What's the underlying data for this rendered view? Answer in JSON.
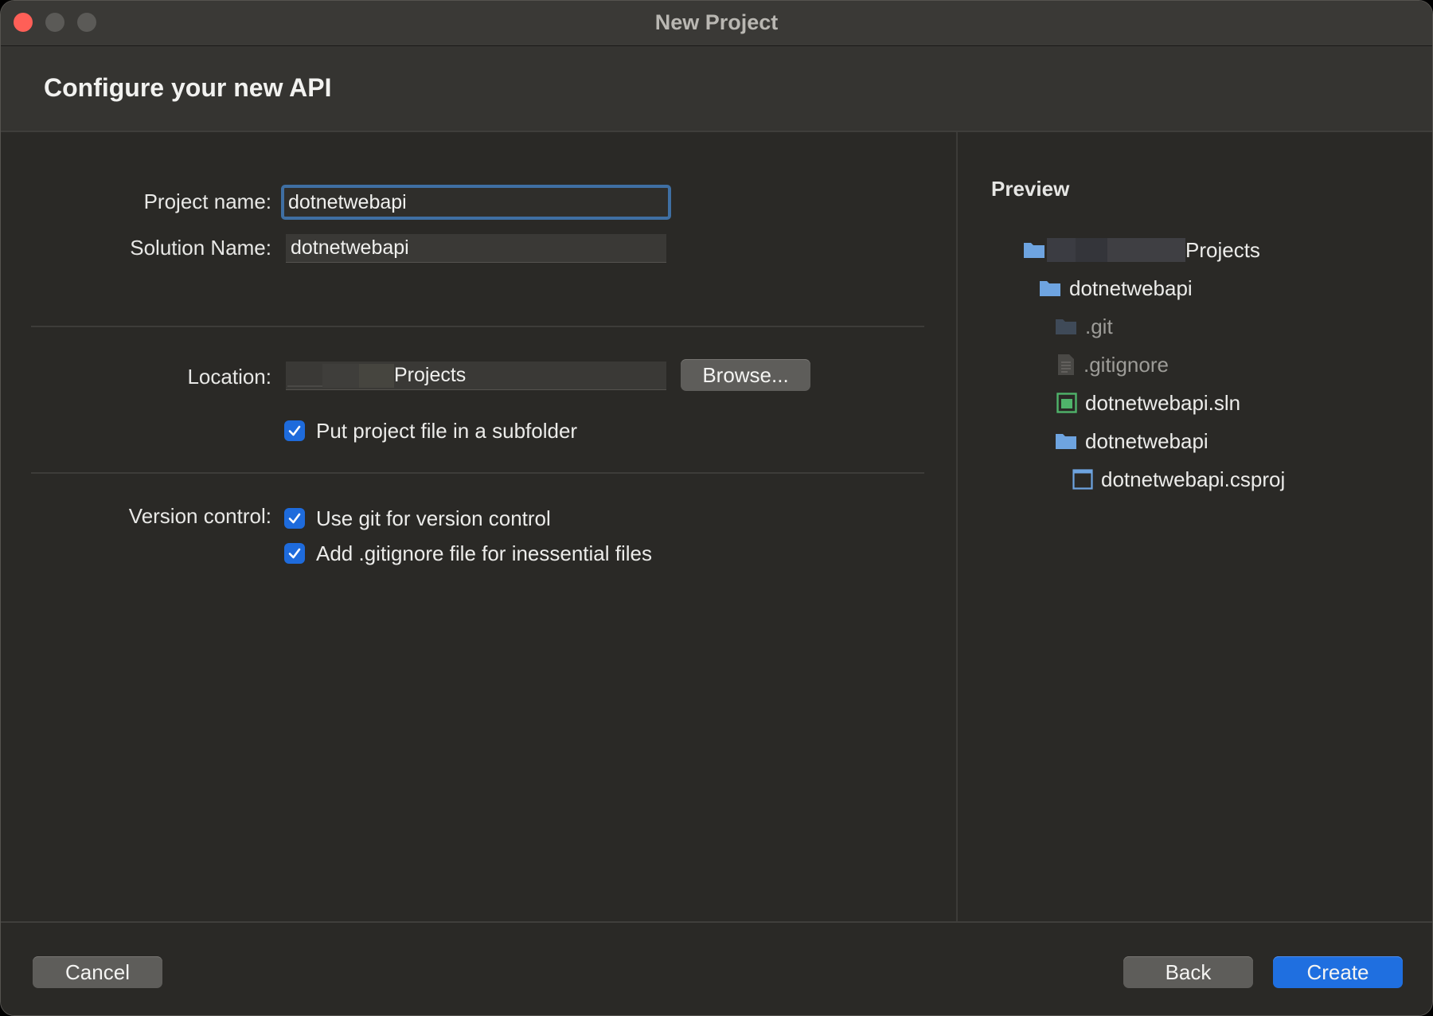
{
  "window": {
    "title": "New Project"
  },
  "header": {
    "title": "Configure your new API"
  },
  "form": {
    "project_name_label": "Project name:",
    "project_name_value": "dotnetwebapi",
    "solution_name_label": "Solution Name:",
    "solution_name_value": "dotnetwebapi",
    "location_label": "Location:",
    "location_value_visible": "Projects",
    "browse_label": "Browse...",
    "subfolder_label": "Put project file in a subfolder",
    "subfolder_checked": true,
    "version_control_label": "Version control:",
    "use_git_label": "Use git for version control",
    "use_git_checked": true,
    "gitignore_label": "Add .gitignore file for inessential files",
    "gitignore_checked": true
  },
  "preview": {
    "title": "Preview",
    "tree": [
      {
        "label": "Projects",
        "icon": "folder-icon",
        "depth": 0
      },
      {
        "label": "dotnetwebapi",
        "icon": "folder-icon",
        "depth": 1
      },
      {
        "label": ".git",
        "icon": "folder-icon",
        "depth": 2,
        "dimmed": true
      },
      {
        "label": ".gitignore",
        "icon": "file-icon",
        "depth": 2,
        "dimmed": true
      },
      {
        "label": "dotnetwebapi.sln",
        "icon": "solution-icon",
        "depth": 2
      },
      {
        "label": "dotnetwebapi",
        "icon": "folder-icon",
        "depth": 2
      },
      {
        "label": "dotnetwebapi.csproj",
        "icon": "project-file-icon",
        "depth": 3
      }
    ]
  },
  "footer": {
    "cancel_label": "Cancel",
    "back_label": "Back",
    "create_label": "Create"
  },
  "colors": {
    "accent": "#1f6fe0",
    "folder": "#6ea4e0",
    "solution": "#4fb36a"
  }
}
